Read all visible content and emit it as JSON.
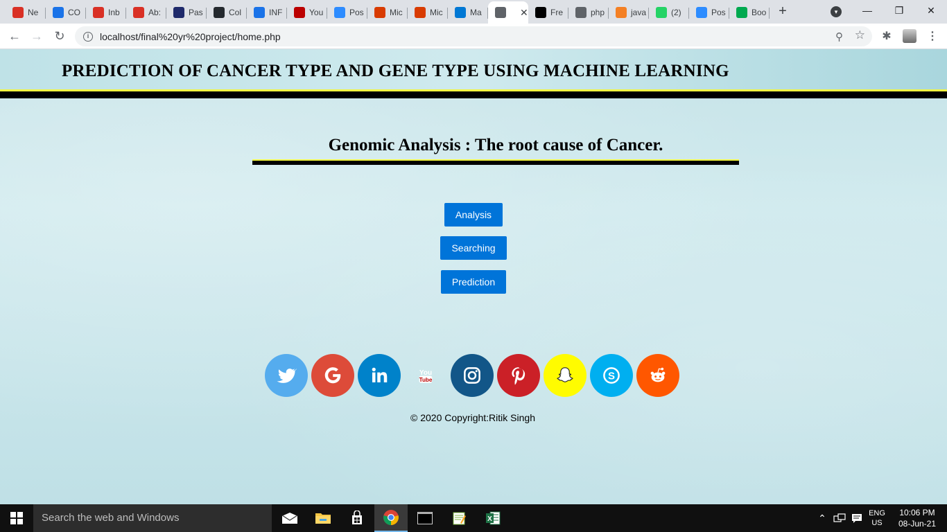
{
  "browser": {
    "tabs": [
      {
        "label": "Ne",
        "icon": "gmail-icon",
        "color": "#d93025"
      },
      {
        "label": "CO",
        "icon": "google-drive-icon",
        "color": "#1a73e8"
      },
      {
        "label": "Inb",
        "icon": "gmail-icon",
        "color": "#d93025"
      },
      {
        "label": "Ab:",
        "icon": "gmail-icon",
        "color": "#d93025"
      },
      {
        "label": "Pas",
        "icon": "page-icon",
        "color": "#1f2a6b"
      },
      {
        "label": "Col",
        "icon": "github-icon",
        "color": "#24292e"
      },
      {
        "label": "INF",
        "icon": "contacts-icon",
        "color": "#1a73e8"
      },
      {
        "label": "You",
        "icon": "youtube-icon",
        "color": "#ff0000"
      },
      {
        "label": "Pos",
        "icon": "zoom-icon",
        "color": "#2d8cff"
      },
      {
        "label": "Mic",
        "icon": "office-icon",
        "color": "#d83b01"
      },
      {
        "label": "Mic",
        "icon": "office-icon",
        "color": "#d83b01"
      },
      {
        "label": "Ma",
        "icon": "outlook-icon",
        "color": "#0078d4"
      },
      {
        "label": "",
        "icon": "globe-icon",
        "color": "#5f6368",
        "active": true
      },
      {
        "label": "Fre",
        "icon": "freepik-icon",
        "color": "#000000"
      },
      {
        "label": "php",
        "icon": "globe-icon",
        "color": "#5f6368"
      },
      {
        "label": "java",
        "icon": "stackoverflow-icon",
        "color": "#f48024"
      },
      {
        "label": "(2)",
        "icon": "whatsapp-icon",
        "color": "#25d366"
      },
      {
        "label": "Pos",
        "icon": "zoom-icon",
        "color": "#2d8cff"
      },
      {
        "label": "Boo",
        "icon": "wikipedia-icon",
        "color": "#00a94f"
      }
    ],
    "close_glyph": "✕",
    "new_tab_glyph": "+",
    "url": "localhost/final%20yr%20project/home.php"
  },
  "page": {
    "title": "PREDICTION OF CANCER TYPE AND GENE TYPE USING MACHINE LEARNING",
    "subtitle": "Genomic Analysis : The root cause of Cancer.",
    "buttons": {
      "analysis": "Analysis",
      "searching": "Searching",
      "prediction": "Prediction"
    },
    "social": [
      {
        "name": "twitter",
        "color": "#55acee"
      },
      {
        "name": "google",
        "color": "#dd4b39"
      },
      {
        "name": "linkedin",
        "color": "#0082ca"
      },
      {
        "name": "youtube",
        "color": "#bb0000"
      },
      {
        "name": "instagram",
        "color": "#125688"
      },
      {
        "name": "pinterest",
        "color": "#cb2027"
      },
      {
        "name": "snapchat",
        "color": "#fffc00"
      },
      {
        "name": "skype",
        "color": "#00aff0"
      },
      {
        "name": "reddit",
        "color": "#ff5700"
      }
    ],
    "copyright": "© 2020 Copyright:Ritik Singh"
  },
  "taskbar": {
    "search_placeholder": "Search the web and Windows",
    "language_top": "ENG",
    "language_bottom": "US",
    "time": "10:06 PM",
    "date": "08-Jun-21"
  },
  "colors": {
    "accent_button": "#0074d9",
    "header_rule_yellow": "#f2f542"
  }
}
